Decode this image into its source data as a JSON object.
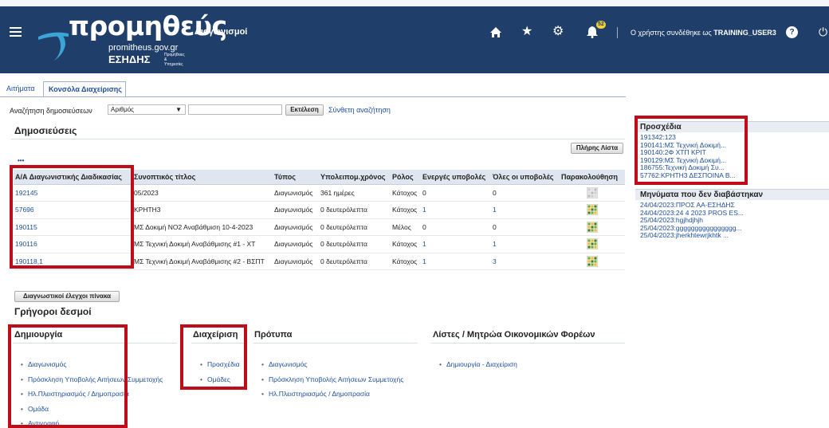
{
  "header": {
    "logo_main": "προμηθεύς",
    "logo_url": "promitheus.gov.gr",
    "logo_esidis": "ΕΣΗΔΗΣ",
    "logo_small": "Προμήθειες & Υπηρεσίες",
    "app_title": "Διαγωνισμοί",
    "notif_count": "52",
    "user_prefix": "Ο χρήστης συνδέθηκε ως",
    "user_name": "TRAINING_USER3",
    "help": "?"
  },
  "tabs": [
    "Αιτήματα",
    "Κονσόλα Διαχείρισης"
  ],
  "search": {
    "label": "Αναζήτηση δημοσιεύσεων",
    "select_value": "Αριθμός",
    "input_value": "",
    "go": "Εκτέλεση",
    "advanced": "Σύνθετη αναζήτηση"
  },
  "publications": {
    "title": "Δημοσιεύσεις",
    "full_list": "Πλήρης Λίστα",
    "dots": "•••",
    "columns": [
      "Α/Α Διαγωνιστικής Διαδικασίας",
      "Συνοπτικός τίτλος",
      "Τύπος",
      "Υπολειπομ.χρόνος",
      "Ρόλος",
      "Ενεργές υποβολές",
      "Όλες οι υποβολές",
      "Παρακολούθηση"
    ],
    "rows": [
      {
        "id": "192145",
        "title": "05/2023",
        "type": "Διαγωνισμός",
        "remaining": "361 ημέρες",
        "role": "Κάτοχος",
        "active": "0",
        "all": "0",
        "track": "grey"
      },
      {
        "id": "57696",
        "title": "ΚΡΗΤΗ3",
        "type": "Διαγωνισμός",
        "remaining": "0 δευτερόλεπτα",
        "role": "Κάτοχος",
        "active": "1",
        "all": "1",
        "track": "color"
      },
      {
        "id": "190115",
        "title": "ΜΣ Δοκιμή ΝΟ2 Αναβάθμιση 10-4-2023",
        "type": "Διαγωνισμός",
        "remaining": "0 δευτερόλεπτα",
        "role": "Μέλος",
        "active": "0",
        "all": "0",
        "track": "color"
      },
      {
        "id": "190116",
        "title": "ΜΣ Τεχνική Δοκιμή Αναβάθμισης #1 - ΧΤ",
        "type": "Διαγωνισμός",
        "remaining": "0 δευτερόλεπτα",
        "role": "Κάτοχος",
        "active": "1",
        "all": "1",
        "track": "color"
      },
      {
        "id": "190118,1",
        "title": "ΜΣ Τεχνική Δοκιμή Αναβάθμισης #2 - ΒΣΠΤ",
        "type": "Διαγωνισμός",
        "remaining": "0 δευτερόλεπτα",
        "role": "Κάτοχος",
        "active": "1",
        "all": "3",
        "track": "color"
      }
    ]
  },
  "diag_button": "Διαγνωστικοί έλεγχοι πίνακα",
  "quick": {
    "title": "Γρήγοροι δεσμοί",
    "create": {
      "title": "Δημιουργία",
      "items": [
        "Διαγωνισμός",
        "Πρόσκληση Υποβολής Αιτήσεων Συμμετοχής",
        "Ηλ.Πλειστηριασμός / Δημοπρασία",
        "Ομάδα",
        "Αντιγραφή"
      ]
    },
    "manage": {
      "title": "Διαχείριση",
      "items": [
        "Προσχέδια",
        "Ομάδες"
      ]
    },
    "templates": {
      "title": "Πρότυπα",
      "items": [
        "Διαγωνισμός",
        "Πρόσκληση Υποβολής Αιτήσεων Συμμετοχής",
        "Ηλ.Πλειστηριασμός / Δημοπρασία"
      ]
    },
    "lists": {
      "title": "Λίστες / Μητρώα Οικονομικών Φορέων",
      "items": [
        "Δημιουργία - Διαχείριση"
      ]
    }
  },
  "drafts": {
    "title": "Προσχέδια",
    "items": [
      "191342:123",
      "190141:ΜΣ Τεχνική Δοκιμή...",
      "190140:2Φ ΧΤΠ ΚΡΙΤ",
      "190129:ΜΣ Τεχνική Δοκιμή...",
      "186755:Τεχνική Δοκιμή Συ...",
      "57762:ΚΡΗΤΗ3 ΔΕΣΠΟΙΝΑ Β..."
    ]
  },
  "messages": {
    "title": "Μηνύματα που δεν διαβάστηκαν",
    "items": [
      "24/04/2023:ΠΡΟΣ ΑΑ-ΕΣΗΔΗΣ",
      "24/04/2023:24 4 2023 PROS ES...",
      "25/04/2023:hgjhdjhjh",
      "25/04/2023:gggggggggggggggg...",
      "25/04/2023:jherkhtewrjkhtk ..."
    ]
  },
  "colors": {
    "header": "#1f3f6a",
    "link": "#1c4f9c",
    "highlight": "#c00c18"
  }
}
